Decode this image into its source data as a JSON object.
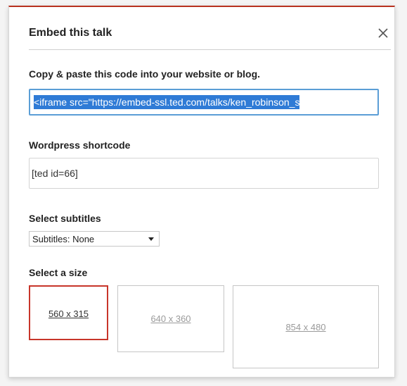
{
  "dialog": {
    "title": "Embed this talk",
    "close_icon": "close-icon",
    "accent_color": "#b8321f"
  },
  "embed": {
    "label": "Copy & paste this code into your website or blog.",
    "code_visible": "<iframe src=\"https://embed-ssl.ted.com/talks/ken_robinson_s",
    "selection_color": "#2f7bd6"
  },
  "wordpress": {
    "label": "Wordpress shortcode",
    "value": "[ted id=66]"
  },
  "subtitles": {
    "label": "Select subtitles",
    "selected": "Subtitles: None"
  },
  "size": {
    "label": "Select a size",
    "options": [
      {
        "label": "560 x 315",
        "selected": true
      },
      {
        "label": "640 x 360",
        "selected": false
      },
      {
        "label": "854 x 480",
        "selected": false
      }
    ],
    "selected_border_color": "#c8352a"
  }
}
